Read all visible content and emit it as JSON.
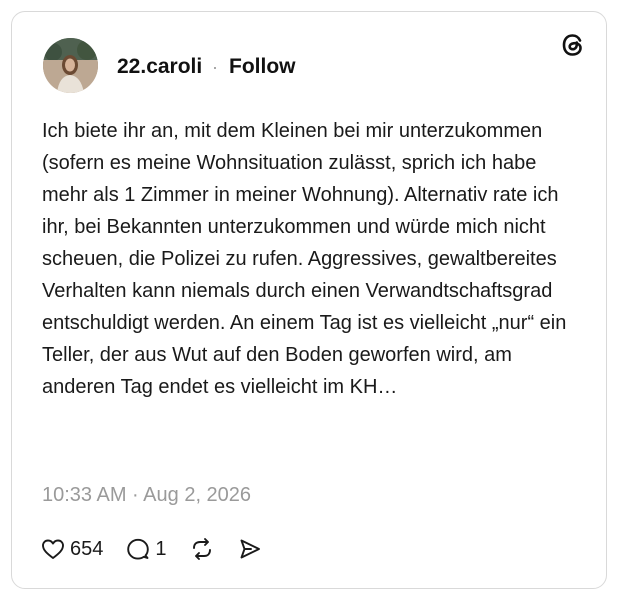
{
  "post": {
    "username": "22.caroli",
    "separator": "·",
    "follow_label": "Follow",
    "text": "Ich biete ihr an, mit dem Kleinen bei mir unterzukommen (sofern es meine Wohnsituation zulässt, sprich ich habe mehr als 1 Zimmer in meiner Wohnung). Alternativ rate ich ihr, bei Bekannten unterzukommen und würde mich nicht scheuen, die Polizei zu rufen. Aggressives, gewaltbereites Verhalten kann niemals durch einen Verwandtschaftsgrad entschuldigt werden. An einem Tag ist es vielleicht „nur“ ein Teller, der aus Wut auf den Boden geworfen wird, am anderen Tag endet es vielleicht im KH…",
    "timestamp": "10:33 AM · Aug 2, 2026"
  },
  "actions": {
    "likes": "654",
    "replies": "1"
  },
  "icons": {
    "logo": "threads-logo-icon",
    "like": "heart-icon",
    "reply": "comment-icon",
    "repost": "repost-icon",
    "share": "send-icon"
  },
  "colors": {
    "text": "#1a1a1a",
    "muted": "#9a9a9a",
    "border": "#d9d9d9"
  }
}
